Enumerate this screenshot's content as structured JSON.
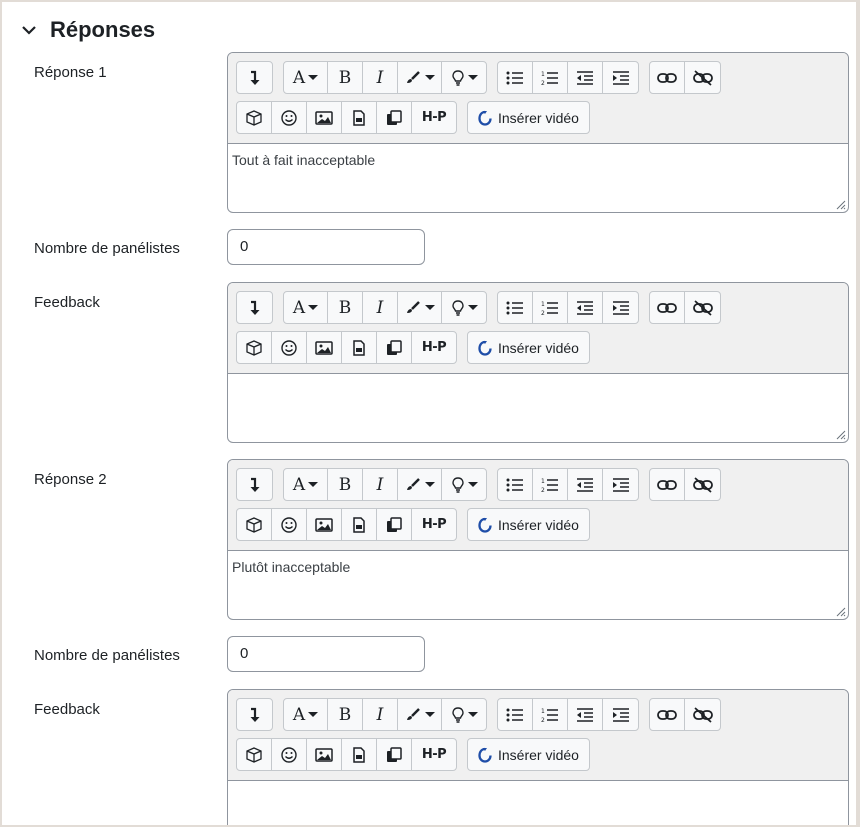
{
  "section": {
    "title": "Réponses"
  },
  "labels": {
    "reponse1": "Réponse 1",
    "nombre": "Nombre de panélistes",
    "feedback": "Feedback",
    "reponse2": "Réponse 2"
  },
  "toolbar": {
    "insert_video_label": "Insérer vidéo"
  },
  "answers": [
    {
      "label": "Réponse 1",
      "text": "Tout à fait inacceptable",
      "panelists": "0",
      "feedback": ""
    },
    {
      "label": "Réponse 2",
      "text": "Plutôt inacceptable",
      "panelists": "0",
      "feedback": ""
    }
  ],
  "icons": [
    "collapse-chevron-icon",
    "show-more-icon",
    "font-icon",
    "bold-icon",
    "italic-icon",
    "brush-icon",
    "lightbulb-icon",
    "bullet-list-icon",
    "numbered-list-icon",
    "outdent-icon",
    "indent-icon",
    "link-icon",
    "unlink-icon",
    "cube-icon",
    "emoji-icon",
    "image-icon",
    "file-icon",
    "copy-icon",
    "h5p-icon",
    "video-icon"
  ]
}
